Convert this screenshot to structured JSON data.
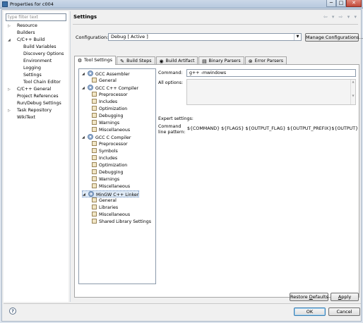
{
  "window": {
    "title": "Properties for c004",
    "controls": [
      "─",
      "□",
      "✕"
    ]
  },
  "left_panel": {
    "filter_placeholder": "type filter text",
    "items": [
      {
        "label": "Resource",
        "indent": 1,
        "twisty": "▷"
      },
      {
        "label": "Builders",
        "indent": 1,
        "twisty": ""
      },
      {
        "label": "C/C++ Build",
        "indent": 1,
        "twisty": "◢"
      },
      {
        "label": "Build Variables",
        "indent": 2,
        "twisty": ""
      },
      {
        "label": "Discovery Options",
        "indent": 2,
        "twisty": ""
      },
      {
        "label": "Environment",
        "indent": 2,
        "twisty": ""
      },
      {
        "label": "Logging",
        "indent": 2,
        "twisty": ""
      },
      {
        "label": "Settings",
        "indent": 2,
        "twisty": ""
      },
      {
        "label": "Tool Chain Editor",
        "indent": 2,
        "twisty": ""
      },
      {
        "label": "C/C++ General",
        "indent": 1,
        "twisty": "▷"
      },
      {
        "label": "Project References",
        "indent": 1,
        "twisty": ""
      },
      {
        "label": "Run/Debug Settings",
        "indent": 1,
        "twisty": ""
      },
      {
        "label": "Task Repository",
        "indent": 1,
        "twisty": "▷"
      },
      {
        "label": "WikiText",
        "indent": 1,
        "twisty": ""
      }
    ]
  },
  "header": {
    "title": "Settings",
    "nav_arrows": "⇦ ▾ ⇨ ▾ ▾"
  },
  "configuration": {
    "label": "Configuration:",
    "value": "Debug  [ Active ]",
    "manage_button": "Manage Configurations..."
  },
  "tabs": [
    {
      "label": "Tool Settings",
      "icon": "⚙",
      "active": true
    },
    {
      "label": "Build Steps",
      "icon": "✎",
      "active": false
    },
    {
      "label": "Build Artifact",
      "icon": "◉",
      "active": false
    },
    {
      "label": "Binary Parsers",
      "icon": "▤",
      "active": false
    },
    {
      "label": "Error Parsers",
      "icon": "⊗",
      "active": false
    }
  ],
  "tool_tree": [
    {
      "label": "GCC Assembler",
      "level": 0,
      "kind": "tool",
      "twisty": "◢"
    },
    {
      "label": "General",
      "level": 1,
      "kind": "page"
    },
    {
      "label": "GCC C++ Compiler",
      "level": 0,
      "kind": "tool",
      "twisty": "◢"
    },
    {
      "label": "Preprocessor",
      "level": 1,
      "kind": "page"
    },
    {
      "label": "Includes",
      "level": 1,
      "kind": "page"
    },
    {
      "label": "Optimization",
      "level": 1,
      "kind": "page"
    },
    {
      "label": "Debugging",
      "level": 1,
      "kind": "page"
    },
    {
      "label": "Warnings",
      "level": 1,
      "kind": "page"
    },
    {
      "label": "Miscellaneous",
      "level": 1,
      "kind": "page"
    },
    {
      "label": "GCC C Compiler",
      "level": 0,
      "kind": "tool",
      "twisty": "◢"
    },
    {
      "label": "Preprocessor",
      "level": 1,
      "kind": "page"
    },
    {
      "label": "Symbols",
      "level": 1,
      "kind": "page"
    },
    {
      "label": "Includes",
      "level": 1,
      "kind": "page"
    },
    {
      "label": "Optimization",
      "level": 1,
      "kind": "page"
    },
    {
      "label": "Debugging",
      "level": 1,
      "kind": "page"
    },
    {
      "label": "Warnings",
      "level": 1,
      "kind": "page"
    },
    {
      "label": "Miscellaneous",
      "level": 1,
      "kind": "page"
    },
    {
      "label": "MinGW C++ Linker",
      "level": 0,
      "kind": "tool",
      "twisty": "◢",
      "selected": true
    },
    {
      "label": "General",
      "level": 1,
      "kind": "page"
    },
    {
      "label": "Libraries",
      "level": 1,
      "kind": "page"
    },
    {
      "label": "Miscellaneous",
      "level": 1,
      "kind": "page"
    },
    {
      "label": "Shared Library Settings",
      "level": 1,
      "kind": "page"
    }
  ],
  "settings": {
    "command_label": "Command:",
    "command_value": "g++ -mwindows",
    "all_options_label": "All options:",
    "all_options_value": "",
    "expert_label": "Expert settings:",
    "pattern_label_1": "Command",
    "pattern_label_2": "line pattern:",
    "pattern_value": "${COMMAND} ${FLAGS} ${OUTPUT_FLAG} ${OUTPUT_PREFIX}${OUTPUT} ${INPUTS}"
  },
  "buttons": {
    "restore_pre": "Restore ",
    "restore_u": "D",
    "restore_post": "efaults",
    "apply_u": "A",
    "apply_post": "pply",
    "ok": "OK",
    "cancel": "Cancel",
    "help": "?"
  }
}
